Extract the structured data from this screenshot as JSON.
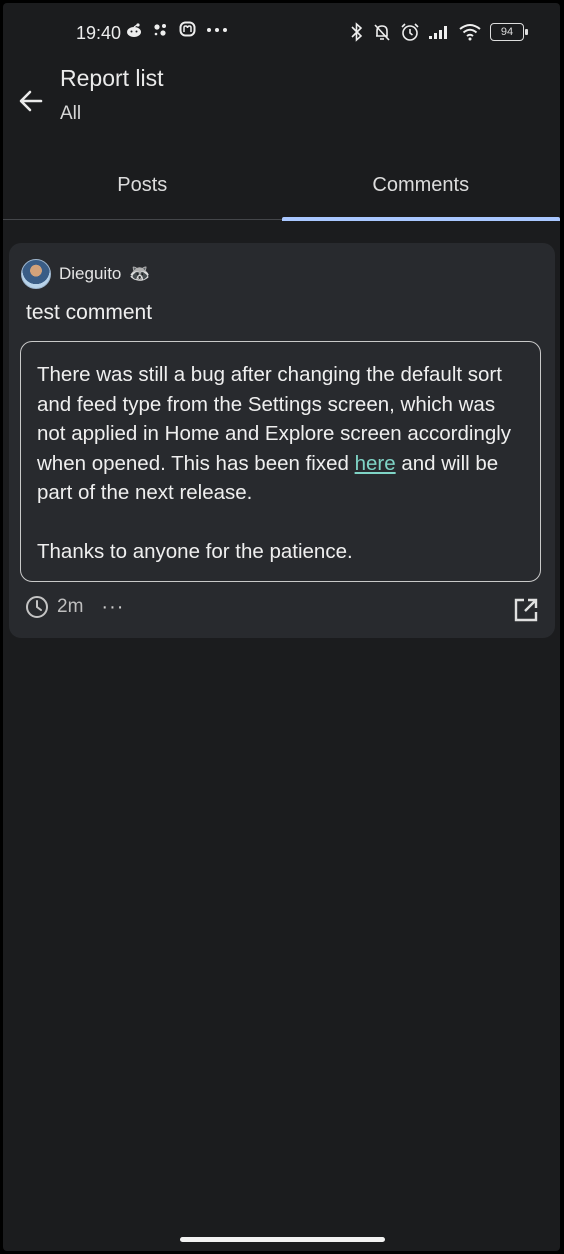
{
  "status": {
    "time": "19:40",
    "battery": "94",
    "left_icons": [
      "reddit-icon",
      "assistant-icon",
      "mastodon-icon",
      "more-dots-icon"
    ],
    "right_icons": [
      "bluetooth-icon",
      "bell-off-icon",
      "alarm-icon",
      "signal-icon",
      "wifi-icon",
      "battery-icon"
    ]
  },
  "appbar": {
    "title": "Report list",
    "subtitle": "All"
  },
  "tabs": [
    {
      "label": "Posts",
      "active": false
    },
    {
      "label": "Comments",
      "active": true
    }
  ],
  "report": {
    "author": "Dieguito",
    "author_badge": "🦝",
    "comment": "test comment",
    "reason": {
      "line1_before": "There was still a bug after changing the default sort and feed type from the Settings screen, which was not applied in Home and Explore screen accordingly when opened. This has been fixed ",
      "link": "here",
      "line1_after": " and will be part of the next release.",
      "line2": "Thanks to anyone for the patience."
    },
    "age": "2m",
    "more_label": "···"
  },
  "colors": {
    "background": "#1b1c1e",
    "card": "#282a2e",
    "accent": "#a9c7ff",
    "link": "#7fd4c6"
  }
}
